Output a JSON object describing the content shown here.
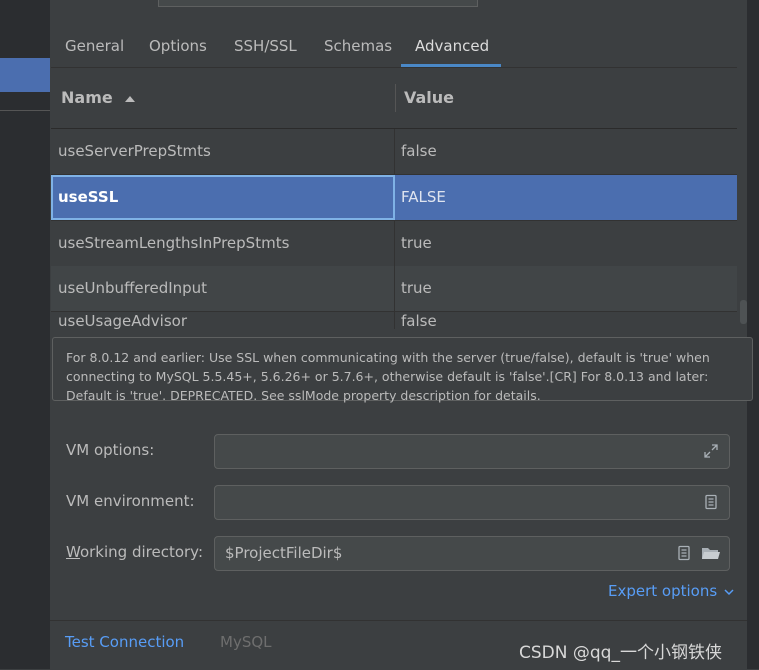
{
  "tabs": [
    {
      "label": "General"
    },
    {
      "label": "Options"
    },
    {
      "label": "SSH/SSL"
    },
    {
      "label": "Schemas"
    },
    {
      "label": "Advanced"
    }
  ],
  "active_tab": "Advanced",
  "table": {
    "headers": {
      "name": "Name",
      "value": "Value",
      "sort_icon": "sort-ascending-icon"
    },
    "rows": [
      {
        "name": "useServerPrepStmts",
        "value": "false"
      },
      {
        "name": "useSSL",
        "value": "FALSE",
        "selected": true
      },
      {
        "name": "useStreamLengthsInPrepStmts",
        "value": "true"
      },
      {
        "name": "useUnbufferedInput",
        "value": "true"
      },
      {
        "name": "useUsageAdvisor",
        "value": "false"
      }
    ]
  },
  "description": "For 8.0.12 and earlier: Use SSL when communicating with the server (true/false), default is 'true' when connecting to MySQL 5.5.45+, 5.6.26+ or 5.7.6+, otherwise default is 'false'.[CR] For 8.0.13 and later: Default is 'true'. DEPRECATED. See sslMode property description for details.",
  "form": {
    "vm_options_label": "VM options:",
    "vm_options_value": "",
    "vm_environment_label": "VM environment:",
    "vm_environment_value": "",
    "working_directory_label_first": "W",
    "working_directory_label_rest": "orking directory:",
    "working_directory_value": "$ProjectFileDir$"
  },
  "expert_options": "Expert options",
  "footer": {
    "test_connection": "Test Connection",
    "driver": "MySQL"
  },
  "watermark": "CSDN @qq_一个小钢铁侠",
  "colors": {
    "accent": "#4a88c7",
    "link": "#589df6",
    "selection": "#4b6eaf"
  }
}
